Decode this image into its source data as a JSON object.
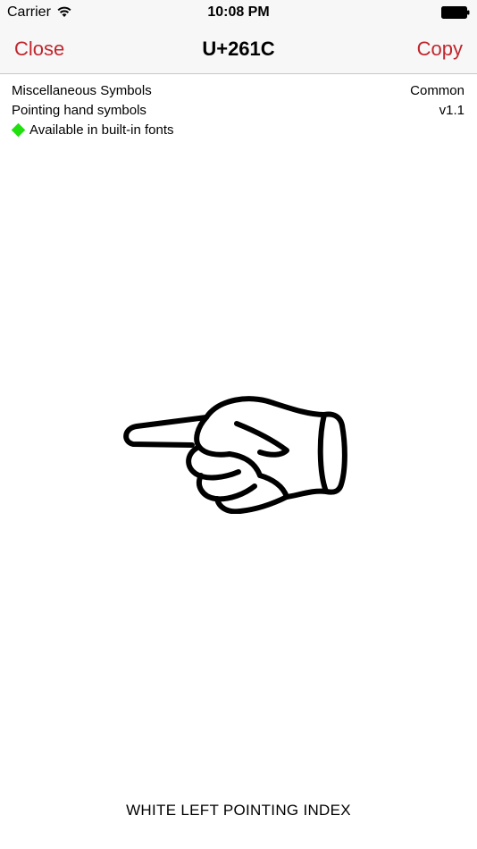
{
  "status_bar": {
    "carrier": "Carrier",
    "time": "10:08 PM",
    "wifi_icon": "wifi-icon",
    "battery_icon": "battery-icon"
  },
  "nav": {
    "close_label": "Close",
    "title": "U+261C",
    "copy_label": "Copy",
    "accent_color": "#c0262d"
  },
  "info": {
    "block": "Miscellaneous Symbols",
    "script": "Common",
    "subgroup": "Pointing hand symbols",
    "version": "v1.1",
    "availability": "Available in built-in fonts",
    "availability_icon": "green-diamond-icon",
    "availability_color": "#22e010"
  },
  "glyph": {
    "char": "☜",
    "icon": "left-pointing-hand-icon"
  },
  "character_name": "WHITE LEFT POINTING INDEX"
}
